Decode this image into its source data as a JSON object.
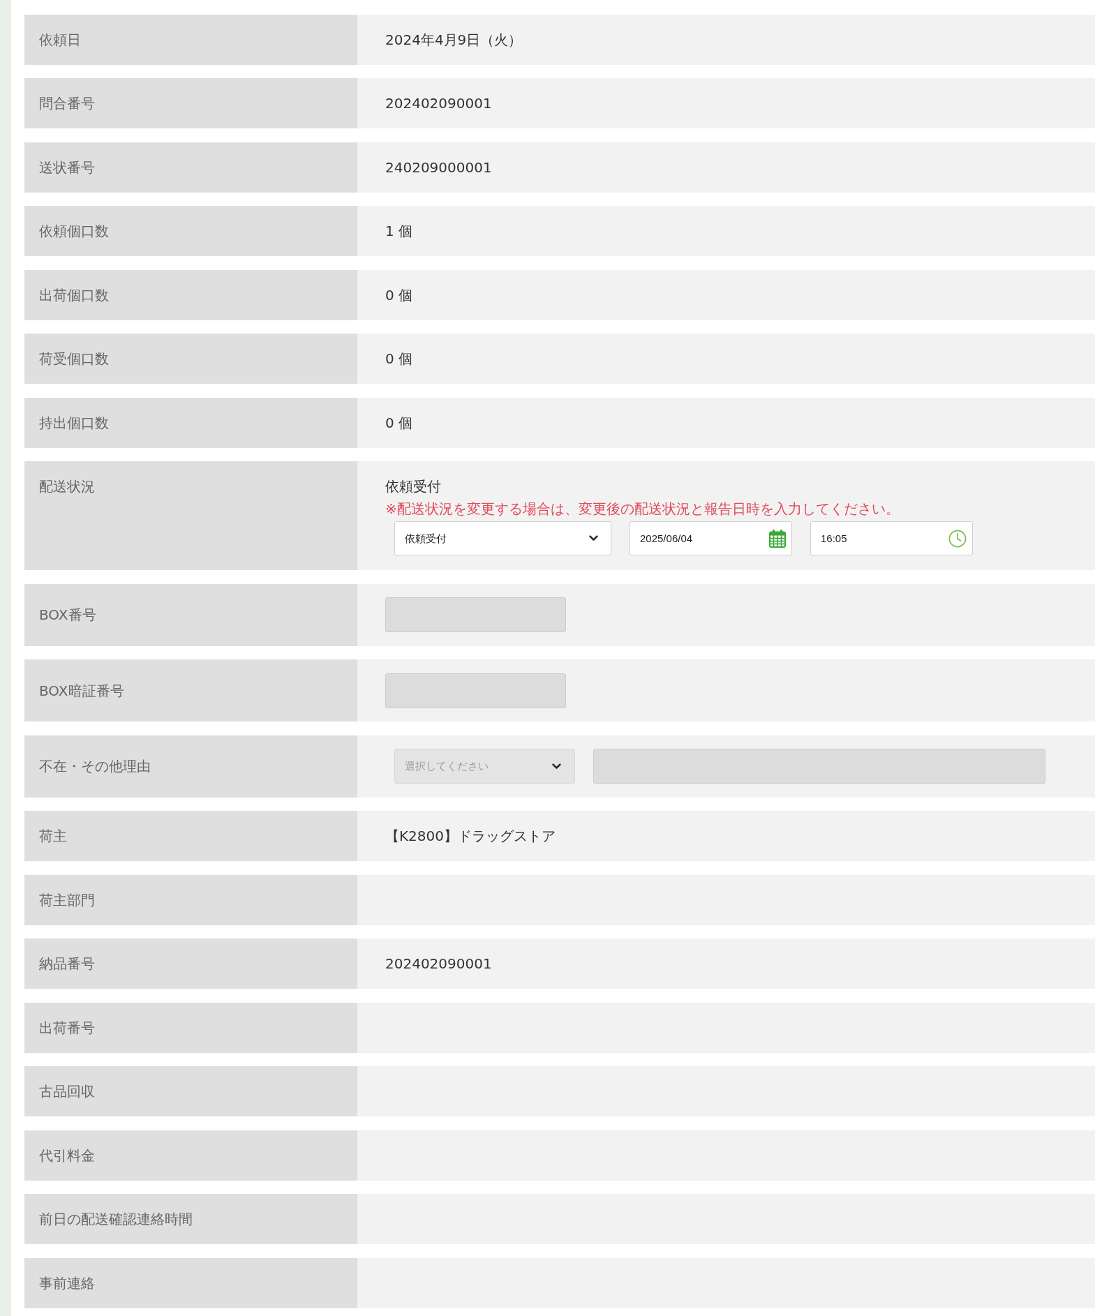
{
  "rows": [
    {
      "kind": "text",
      "label": "依頼日",
      "value": "2024年4月9日（火）"
    },
    {
      "kind": "text",
      "label": "問合番号",
      "value": "202402090001"
    },
    {
      "kind": "text",
      "label": "送状番号",
      "value": "240209000001"
    },
    {
      "kind": "text",
      "label": "依頼個口数",
      "value": "1 個"
    },
    {
      "kind": "text",
      "label": "出荷個口数",
      "value": "0 個"
    },
    {
      "kind": "text",
      "label": "荷受個口数",
      "value": "0 個"
    },
    {
      "kind": "text",
      "label": "持出個口数",
      "value": "0 個"
    },
    {
      "kind": "status",
      "label": "配送状況",
      "current": "依頼受付",
      "note": "※配送状況を変更する場合は、変更後の配送状況と報告日時を入力してください。",
      "status_select": {
        "value": "依頼受付",
        "disabled": false
      },
      "date_field": {
        "value": "2025/06/04",
        "disabled": false
      },
      "time_field": {
        "value": "16:05",
        "disabled": false
      }
    },
    {
      "kind": "input",
      "label": "BOX番号",
      "field": {
        "disabled": true
      }
    },
    {
      "kind": "input",
      "label": "BOX暗証番号",
      "field": {
        "disabled": true
      }
    },
    {
      "kind": "select_input",
      "label": "不在・その他理由",
      "select": {
        "placeholder": "選択してください",
        "disabled": true
      },
      "field": {
        "disabled": true
      }
    },
    {
      "kind": "text",
      "label": "荷主",
      "value": "【K2800】ドラッグストア"
    },
    {
      "kind": "text",
      "label": "荷主部門"
    },
    {
      "kind": "text",
      "label": "納品番号",
      "value": "202402090001"
    },
    {
      "kind": "text",
      "label": "出荷番号"
    },
    {
      "kind": "text",
      "label": "古品回収"
    },
    {
      "kind": "text",
      "label": "代引料金"
    },
    {
      "kind": "text",
      "label": "前日の配送確認連絡時間"
    },
    {
      "kind": "text",
      "label": "事前連絡"
    }
  ]
}
